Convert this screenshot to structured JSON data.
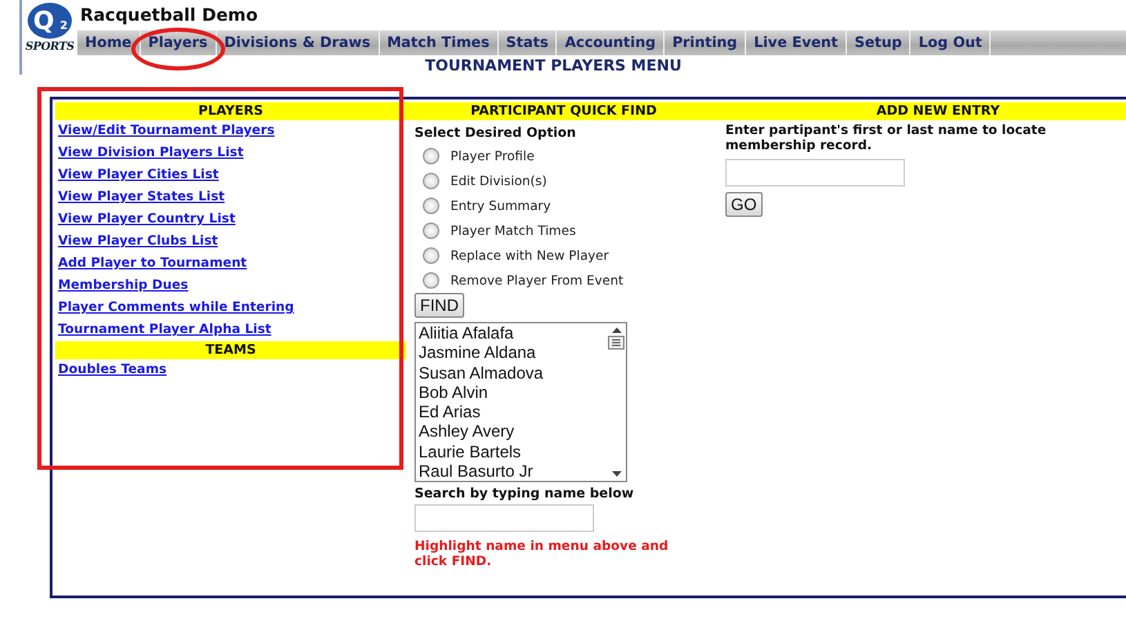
{
  "header": {
    "logo_letter": "Q",
    "logo_sub": "2",
    "logo_caption": "SPORTS",
    "title": "Racquetball Demo"
  },
  "nav": {
    "tabs": [
      {
        "label": "Home",
        "circled": false
      },
      {
        "label": "Players",
        "circled": true
      },
      {
        "label": "Divisions & Draws",
        "circled": false
      },
      {
        "label": "Match Times",
        "circled": false
      },
      {
        "label": "Stats",
        "circled": false
      },
      {
        "label": "Accounting",
        "circled": false
      },
      {
        "label": "Printing",
        "circled": false
      },
      {
        "label": "Live Event",
        "circled": false
      },
      {
        "label": "Setup",
        "circled": false
      },
      {
        "label": "Log Out",
        "circled": false
      }
    ]
  },
  "page_title": "TOURNAMENT PLAYERS MENU",
  "players_panel": {
    "outlined": true,
    "heading": "PLAYERS",
    "links": [
      "View/Edit Tournament Players",
      "View Division Players List",
      "View Player Cities List",
      "View Player States List",
      "View Player Country List",
      "View Player Clubs List",
      "Add Player to Tournament",
      "Membership Dues",
      "Player Comments while Entering",
      "Tournament Player Alpha List"
    ],
    "teams_heading": "TEAMS",
    "teams_links": [
      "Doubles Teams"
    ]
  },
  "quick_find": {
    "heading": "PARTICIPANT QUICK FIND",
    "prompt": "Select Desired Option",
    "options": [
      {
        "label": "Player Profile",
        "selected": false
      },
      {
        "label": "Edit Division(s)",
        "selected": false
      },
      {
        "label": "Entry Summary",
        "selected": false
      },
      {
        "label": "Player Match Times",
        "selected": false
      },
      {
        "label": "Replace with New Player",
        "selected": false
      },
      {
        "label": "Remove Player From Event",
        "selected": false
      }
    ],
    "find_button": "FIND",
    "names": [
      "Aliitia Afalafa",
      "Jasmine Aldana",
      "Susan Almadova",
      "Bob Alvin",
      "Ed Arias",
      "Ashley Avery",
      "Laurie Bartels",
      "Raul Basurto Jr"
    ],
    "search_label": "Search by typing name below",
    "hint": "Highlight name in menu above and click FIND."
  },
  "add_entry": {
    "heading": "ADD NEW ENTRY",
    "instructions": "Enter partipant's first or last name to locate membership record.",
    "go_button": "GO"
  }
}
